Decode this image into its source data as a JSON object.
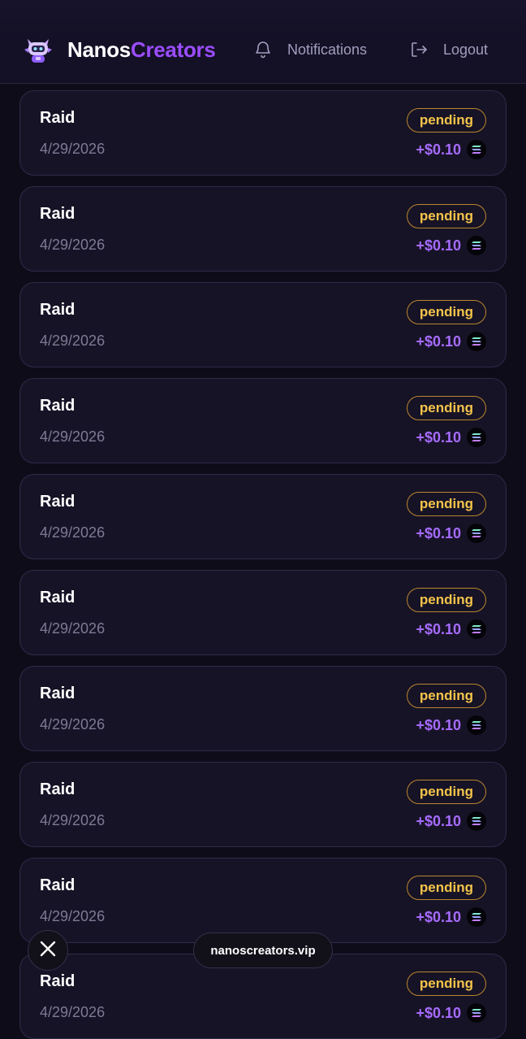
{
  "header": {
    "brand_part1": "Nanos",
    "brand_part2": "Creators",
    "notifications_label": "Notifications",
    "logout_label": "Logout"
  },
  "transactions": [
    {
      "title": "Raid",
      "date": "4/29/2026",
      "status": "pending",
      "amount": "+$0.10"
    },
    {
      "title": "Raid",
      "date": "4/29/2026",
      "status": "pending",
      "amount": "+$0.10"
    },
    {
      "title": "Raid",
      "date": "4/29/2026",
      "status": "pending",
      "amount": "+$0.10"
    },
    {
      "title": "Raid",
      "date": "4/29/2026",
      "status": "pending",
      "amount": "+$0.10"
    },
    {
      "title": "Raid",
      "date": "4/29/2026",
      "status": "pending",
      "amount": "+$0.10"
    },
    {
      "title": "Raid",
      "date": "4/29/2026",
      "status": "pending",
      "amount": "+$0.10"
    },
    {
      "title": "Raid",
      "date": "4/29/2026",
      "status": "pending",
      "amount": "+$0.10"
    },
    {
      "title": "Raid",
      "date": "4/29/2026",
      "status": "pending",
      "amount": "+$0.10"
    },
    {
      "title": "Raid",
      "date": "4/29/2026",
      "status": "pending",
      "amount": "+$0.10"
    },
    {
      "title": "Raid",
      "date": "4/29/2026",
      "status": "pending",
      "amount": "+$0.10"
    }
  ],
  "browser": {
    "url": "nanoscreators.vip"
  },
  "colors": {
    "brand_accent": "#9b4dff",
    "amount": "#a66cff",
    "pending": "#f4c44a"
  },
  "icons": {
    "logo": "robot-mascot-icon",
    "notifications": "bell-icon",
    "logout": "logout-icon",
    "currency": "solana-icon",
    "close": "close-icon"
  }
}
